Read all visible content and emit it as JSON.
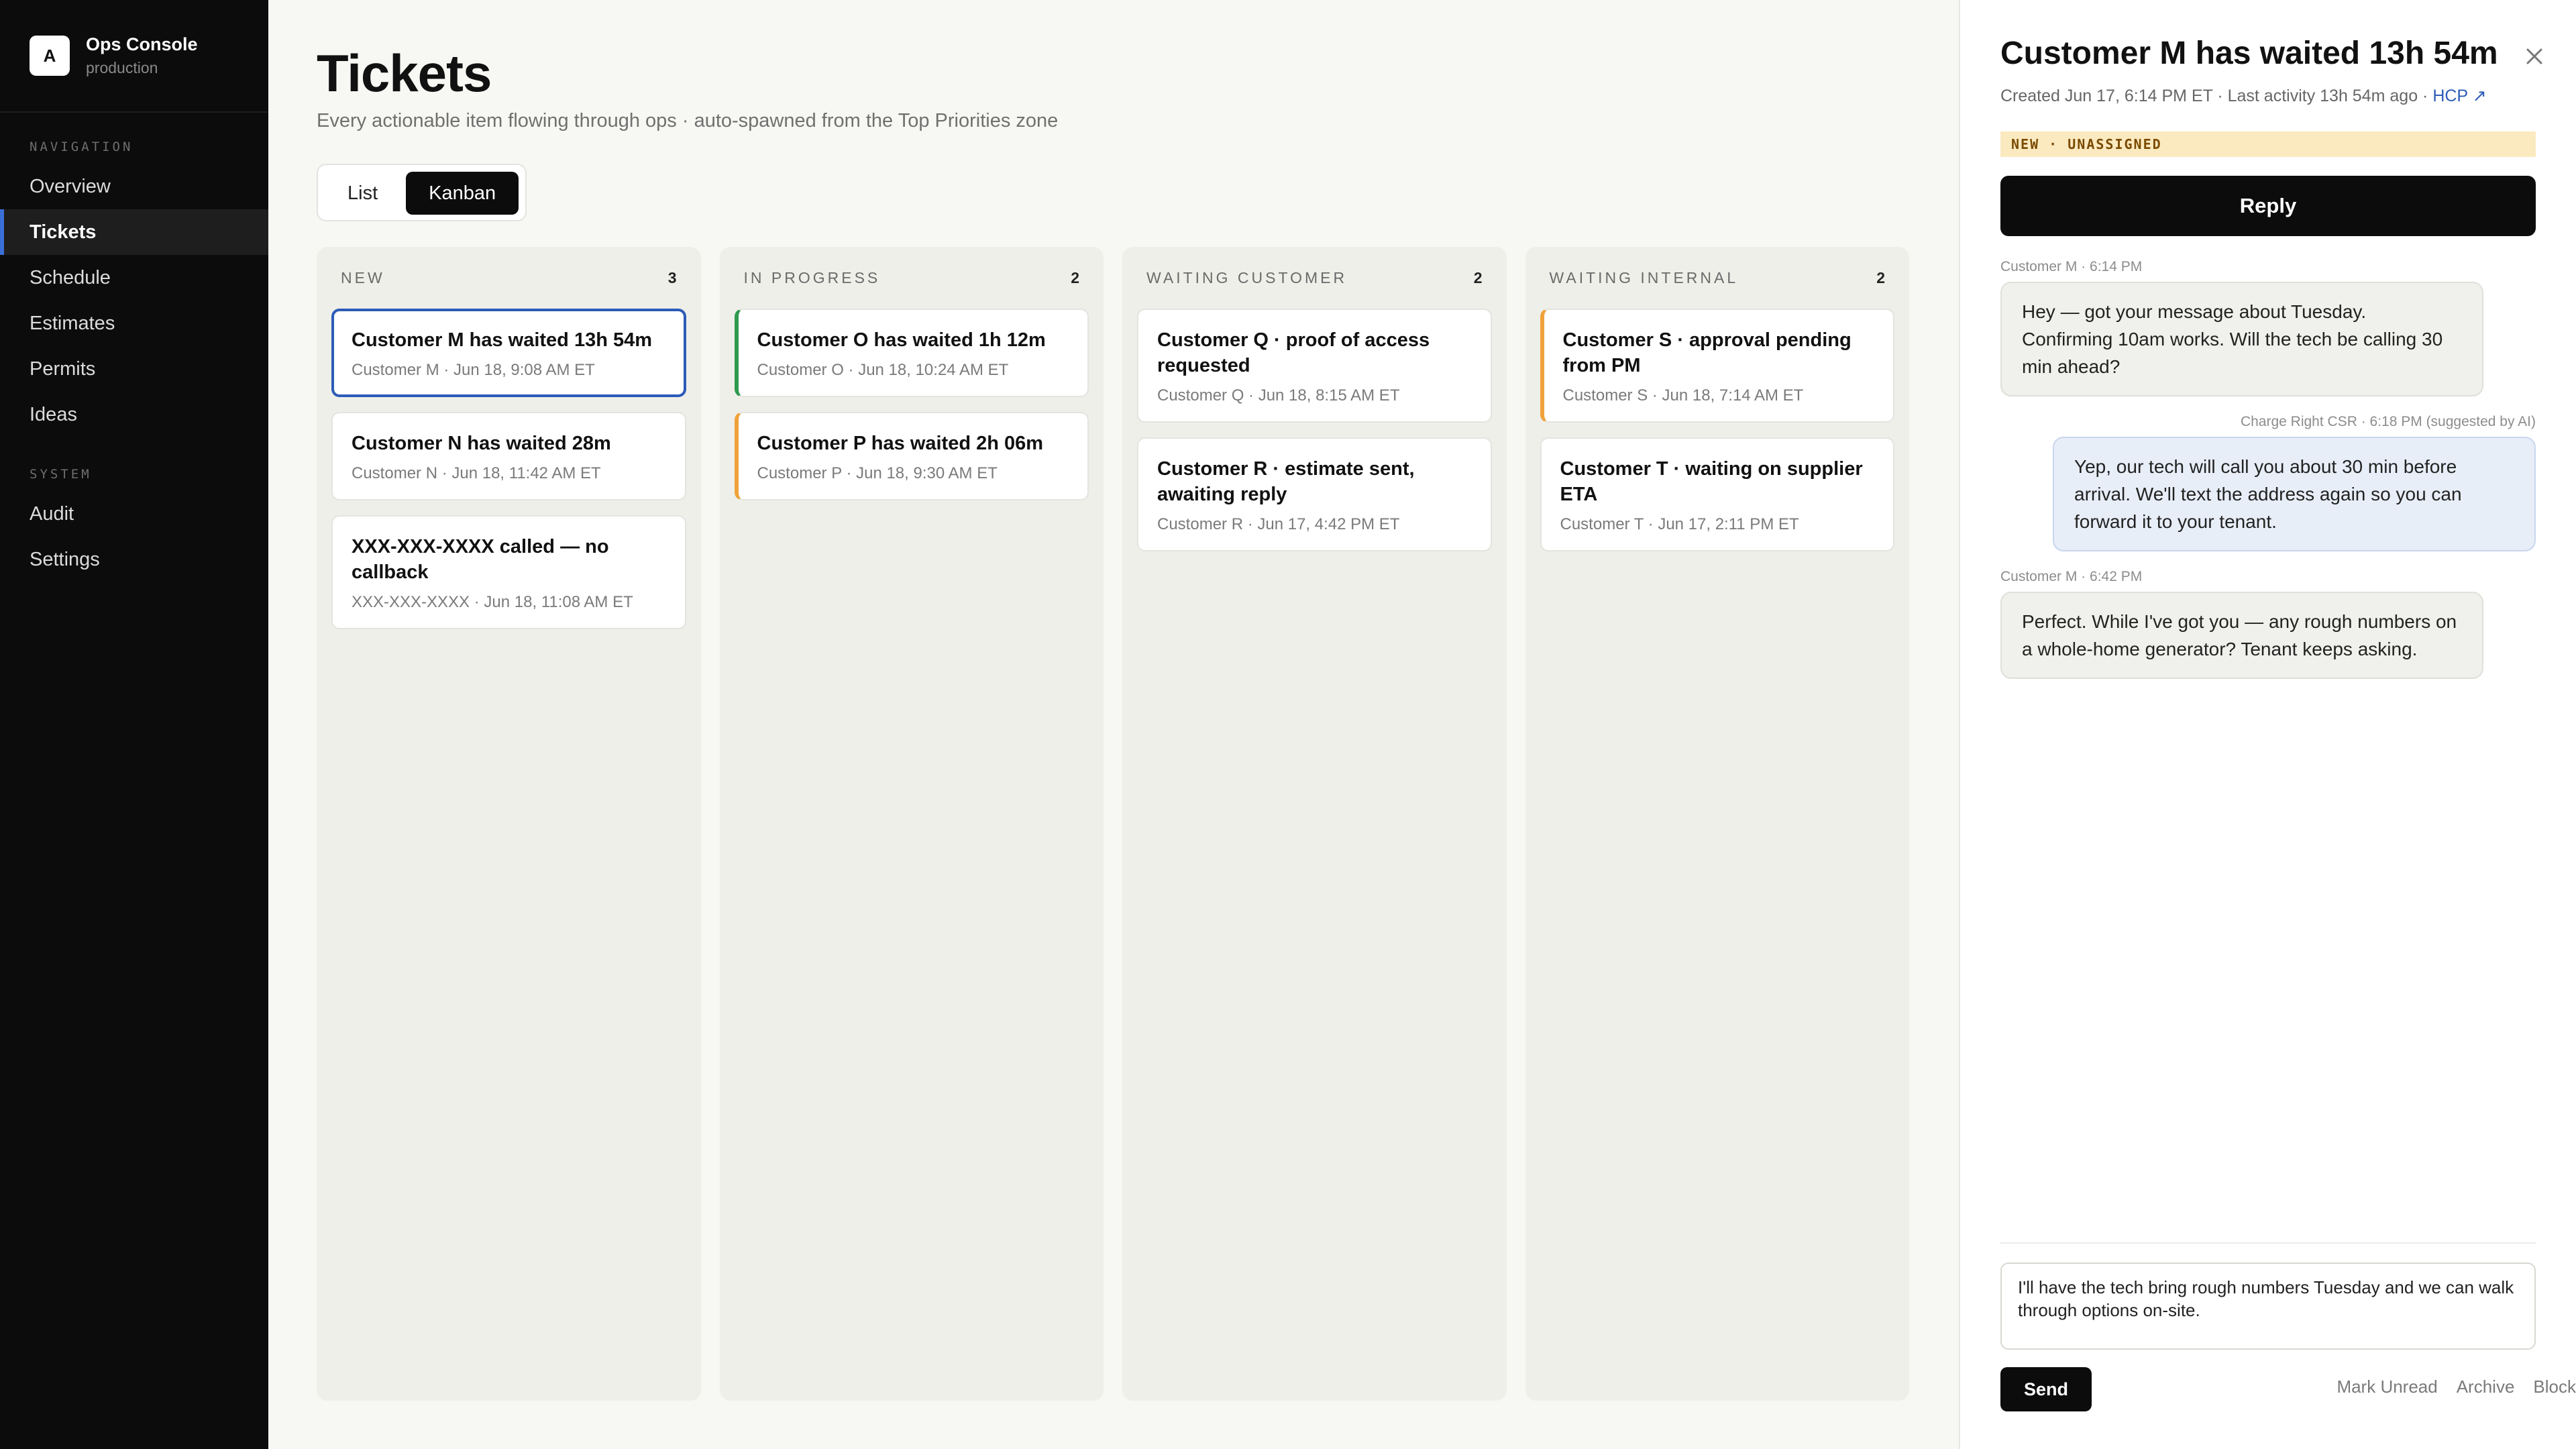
{
  "brand": {
    "logo_letter": "A",
    "name": "Ops Console",
    "env": "production"
  },
  "sidebar": {
    "nav_label": "NAVIGATION",
    "nav_items": [
      {
        "label": "Overview"
      },
      {
        "label": "Tickets"
      },
      {
        "label": "Schedule"
      },
      {
        "label": "Estimates"
      },
      {
        "label": "Permits"
      },
      {
        "label": "Ideas"
      }
    ],
    "system_label": "SYSTEM",
    "system_items": [
      {
        "label": "Audit"
      },
      {
        "label": "Settings"
      }
    ],
    "active_item": "Tickets",
    "accent_color": "#3b6fd8"
  },
  "page": {
    "title": "Tickets",
    "subtitle": "Every actionable item flowing through ops · auto-spawned from the Top Priorities zone"
  },
  "view_toggle": {
    "list_label": "List",
    "kanban_label": "Kanban",
    "selected": "Kanban"
  },
  "board": {
    "columns": [
      {
        "title": "NEW",
        "count": "3",
        "cards": [
          {
            "title": "Customer M has waited 13h 54m",
            "meta": "Customer M · Jun 18, 9:08 AM ET"
          },
          {
            "title": "Customer N has waited 28m",
            "meta": "Customer N · Jun 18, 11:42 AM ET"
          },
          {
            "title": "XXX-XXX-XXXX called — no callback",
            "meta": "XXX-XXX-XXXX · Jun 18, 11:08 AM ET"
          }
        ]
      },
      {
        "title": "IN PROGRESS",
        "count": "2",
        "cards": [
          {
            "title": "Customer O has waited 1h 12m",
            "meta": "Customer O · Jun 18, 10:24 AM ET"
          },
          {
            "title": "Customer P has waited 2h 06m",
            "meta": "Customer P · Jun 18, 9:30 AM ET"
          }
        ]
      },
      {
        "title": "WAITING CUSTOMER",
        "count": "2",
        "cards": [
          {
            "title": "Customer Q · proof of access requested",
            "meta": "Customer Q · Jun 18, 8:15 AM ET"
          },
          {
            "title": "Customer R · estimate sent, awaiting reply",
            "meta": "Customer R · Jun 17, 4:42 PM ET"
          }
        ]
      },
      {
        "title": "WAITING INTERNAL",
        "count": "2",
        "cards": [
          {
            "title": "Customer S · approval pending from PM",
            "meta": "Customer S · Jun 18, 7:14 AM ET"
          },
          {
            "title": "Customer T · waiting on supplier ETA",
            "meta": "Customer T · Jun 17, 2:11 PM ET"
          }
        ]
      }
    ],
    "accent_colors": {
      "green": "#2e9a4e",
      "orange": "#f0a23a",
      "selected": "#2d5cb8"
    }
  },
  "detail": {
    "title": "Customer M has waited 13h 54m",
    "meta": "Created Jun 17, 6:14 PM ET · Last activity 13h 54m ago ·",
    "link_label": "HCP ↗",
    "status": "NEW · UNASSIGNED",
    "reply_label": "Reply",
    "messages": [
      {
        "label": "Customer M · 6:14 PM",
        "text": "Hey — got your message about Tuesday. Confirming 10am works. Will the tech be calling 30 min ahead?"
      },
      {
        "label": "Charge Right CSR · 6:18 PM (suggested by AI)",
        "text": "Yep, our tech will call you about 30 min before arrival. We'll text the address again so you can forward it to your tenant."
      },
      {
        "label": "Customer M · 6:42 PM",
        "text": "Perfect. While I've got you — any rough numbers on a whole-home generator? Tenant keeps asking."
      }
    ],
    "composer_value": "I'll have the tech bring rough numbers Tuesday and we can walk through options on-site.",
    "send_label": "Send",
    "actions": {
      "mark_unread": "Mark Unread",
      "archive": "Archive",
      "block": "Block"
    },
    "close_icon": "close-icon"
  }
}
